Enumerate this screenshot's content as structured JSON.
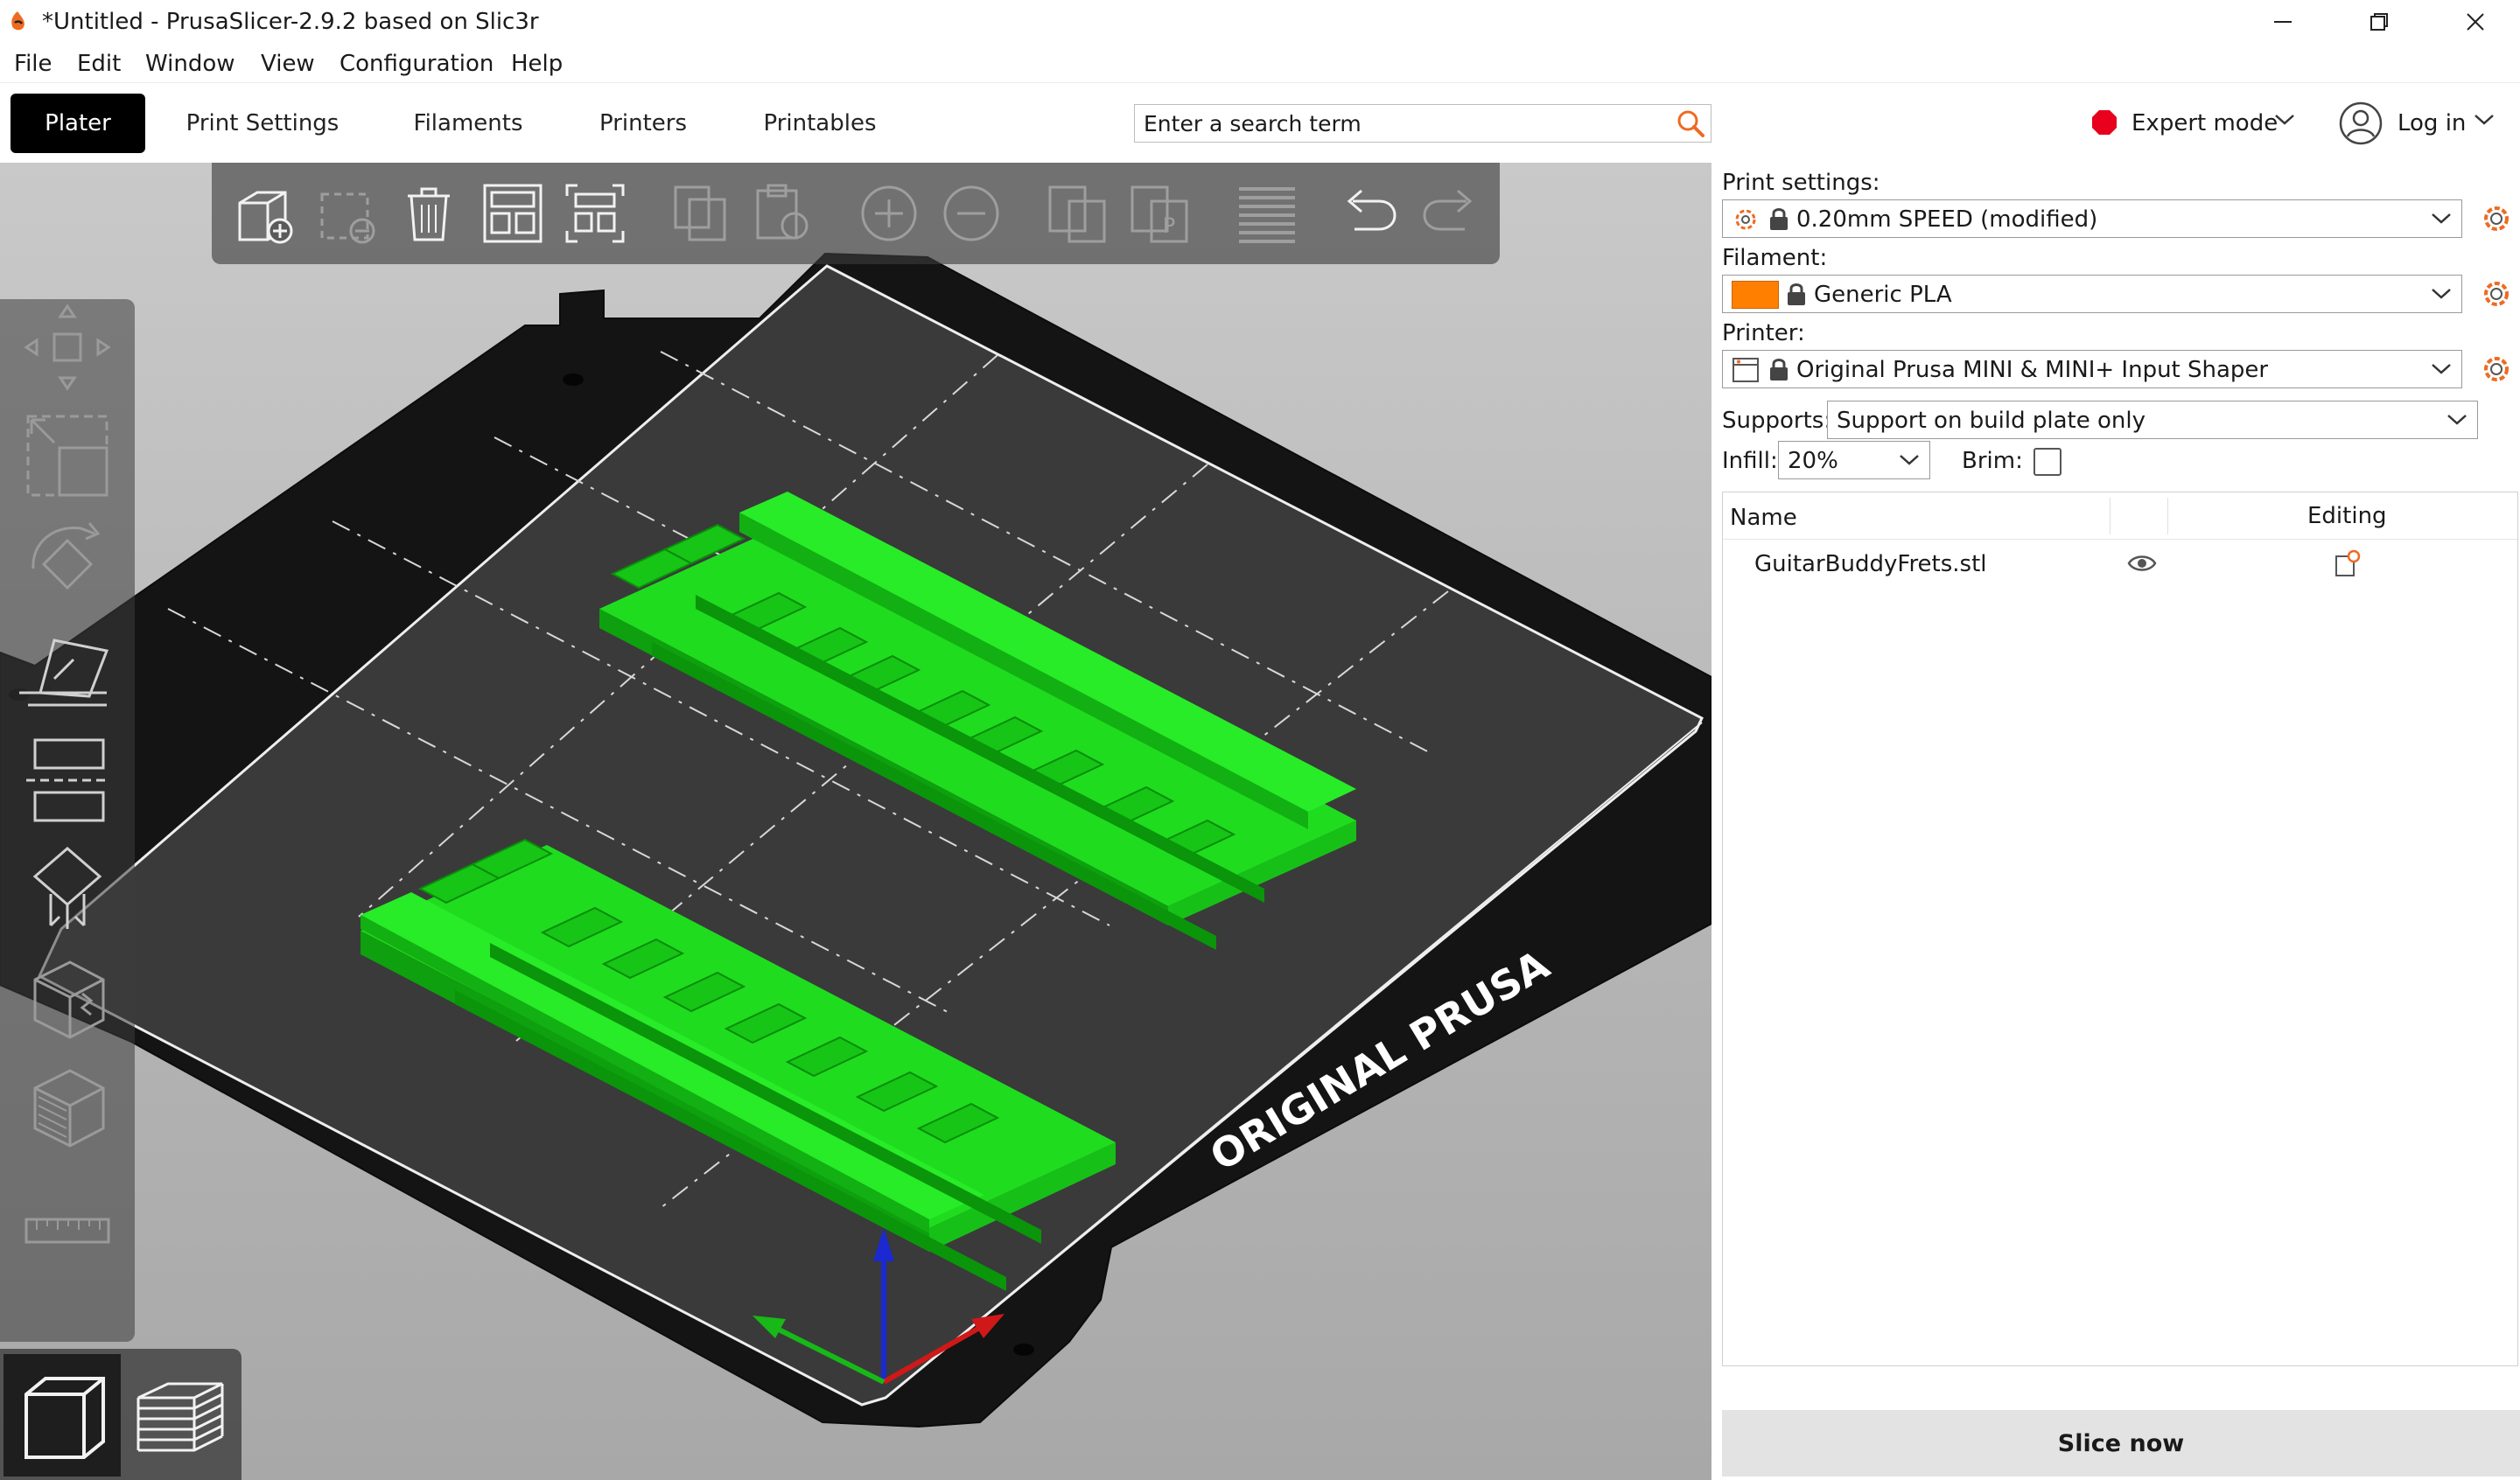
{
  "window": {
    "title": "*Untitled - PrusaSlicer-2.9.2 based on Slic3r",
    "minimize_icon": "minimize-icon",
    "maximize_icon": "restore-icon",
    "close_icon": "close-icon"
  },
  "menu": [
    "File",
    "Edit",
    "Window",
    "View",
    "Configuration",
    "Help"
  ],
  "tabs": [
    {
      "label": "Plater",
      "active": true
    },
    {
      "label": "Print Settings",
      "active": false
    },
    {
      "label": "Filaments",
      "active": false
    },
    {
      "label": "Printers",
      "active": false
    },
    {
      "label": "Printables",
      "active": false
    }
  ],
  "search": {
    "placeholder": "Enter a search term",
    "value": ""
  },
  "mode": {
    "label": "Expert mode",
    "color": "#e8001c"
  },
  "login": {
    "label": "Log in"
  },
  "viewport": {
    "bed_label": "ORIGINAL PRUSA",
    "model_color": "#1fdc1f",
    "axis_colors": {
      "x": "#d01818",
      "y": "#18b818",
      "z": "#1a2ad0"
    },
    "top_toolbar": [
      "add-object-icon",
      "delete-icon",
      "delete-all-icon",
      "arrange-icon",
      "arrange-selection-icon",
      "copy-icon",
      "paste-icon",
      "add-instance-icon",
      "remove-instance-icon",
      "split-to-objects-icon",
      "split-to-parts-icon",
      "variable-layer-height-icon",
      "undo-icon",
      "redo-icon"
    ],
    "left_toolbar": [
      "move-icon",
      "scale-icon",
      "rotate-icon",
      "place-on-face-icon",
      "cut-icon",
      "support-painting-icon",
      "seam-painting-icon",
      "fuzzy-skin-icon",
      "measure-icon"
    ],
    "view_switch": [
      "3d-view-icon",
      "preview-icon"
    ]
  },
  "sidebar": {
    "print_settings_label": "Print settings:",
    "print_preset": "0.20mm SPEED (modified)",
    "filament_label": "Filament:",
    "filament_preset": "Generic PLA",
    "filament_color": "#ff8000",
    "printer_label": "Printer:",
    "printer_preset": "Original Prusa MINI & MINI+ Input Shaper",
    "supports_label": "Supports:",
    "supports_value": "Support on build plate only",
    "infill_label": "Infill:",
    "infill_value": "20%",
    "brim_label": "Brim:",
    "brim_checked": false
  },
  "object_list": {
    "columns": {
      "name": "Name",
      "editing": "Editing"
    },
    "rows": [
      {
        "name": "GuitarBuddyFrets.stl"
      }
    ]
  },
  "slice_button": "Slice now"
}
